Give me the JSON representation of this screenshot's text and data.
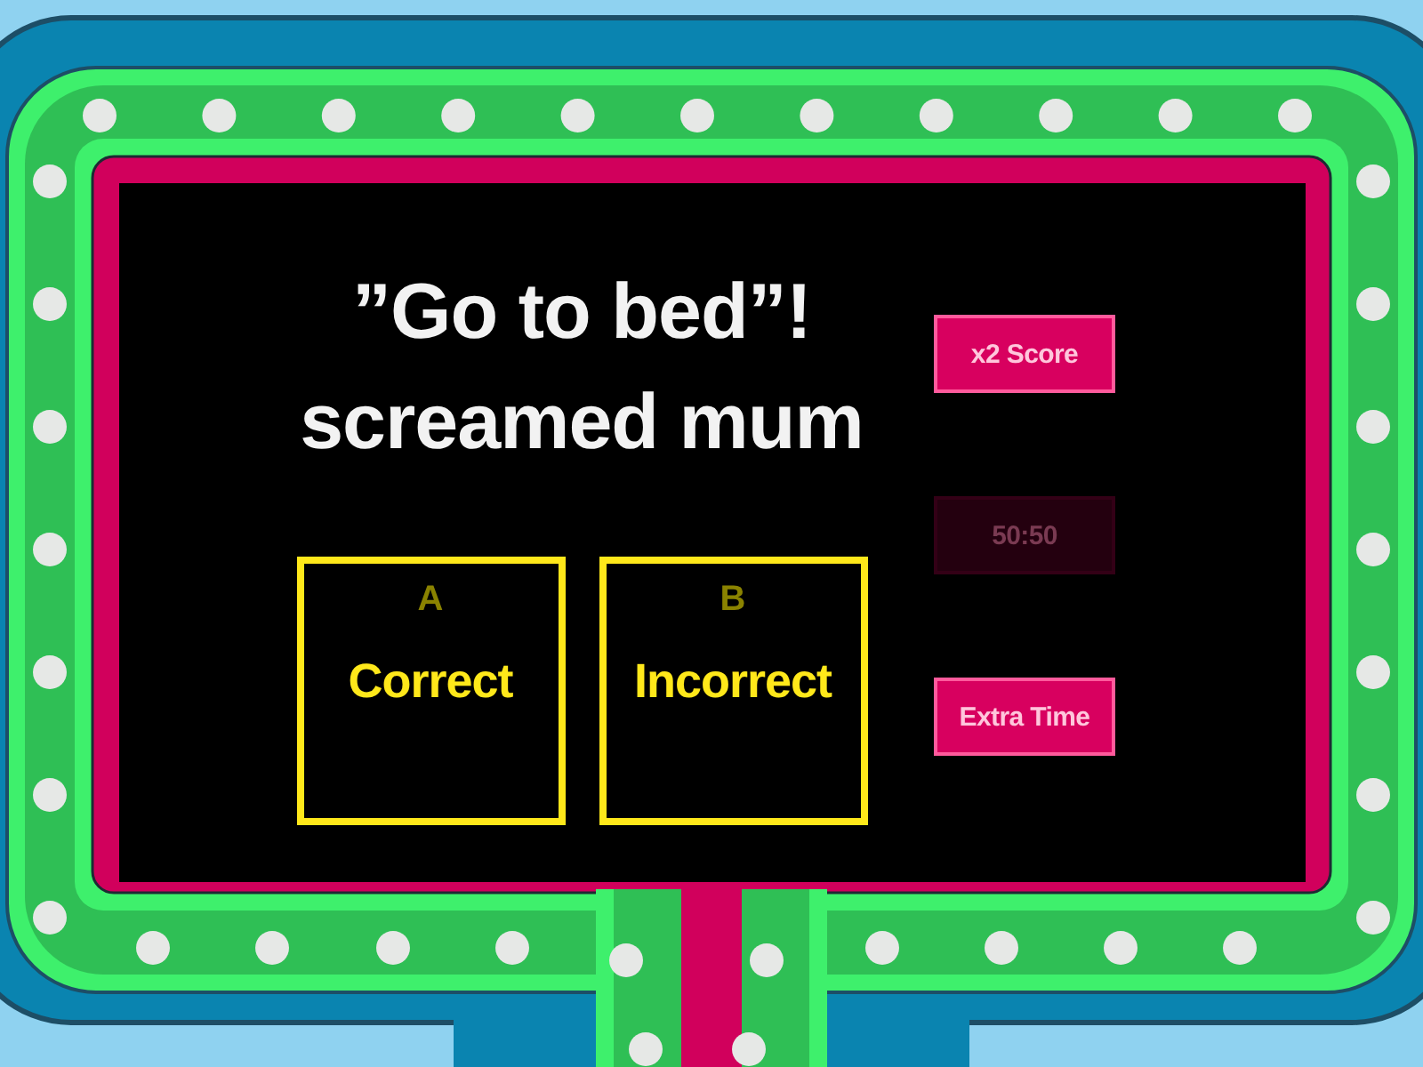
{
  "question": "”Go to bed”! screamed mum",
  "answers": [
    {
      "letter": "A",
      "text": "Correct"
    },
    {
      "letter": "B",
      "text": "Incorrect"
    }
  ],
  "powerups": [
    {
      "label": "x2 Score",
      "disabled": false
    },
    {
      "label": "50:50",
      "disabled": true
    },
    {
      "label": "Extra Time",
      "disabled": false
    }
  ]
}
